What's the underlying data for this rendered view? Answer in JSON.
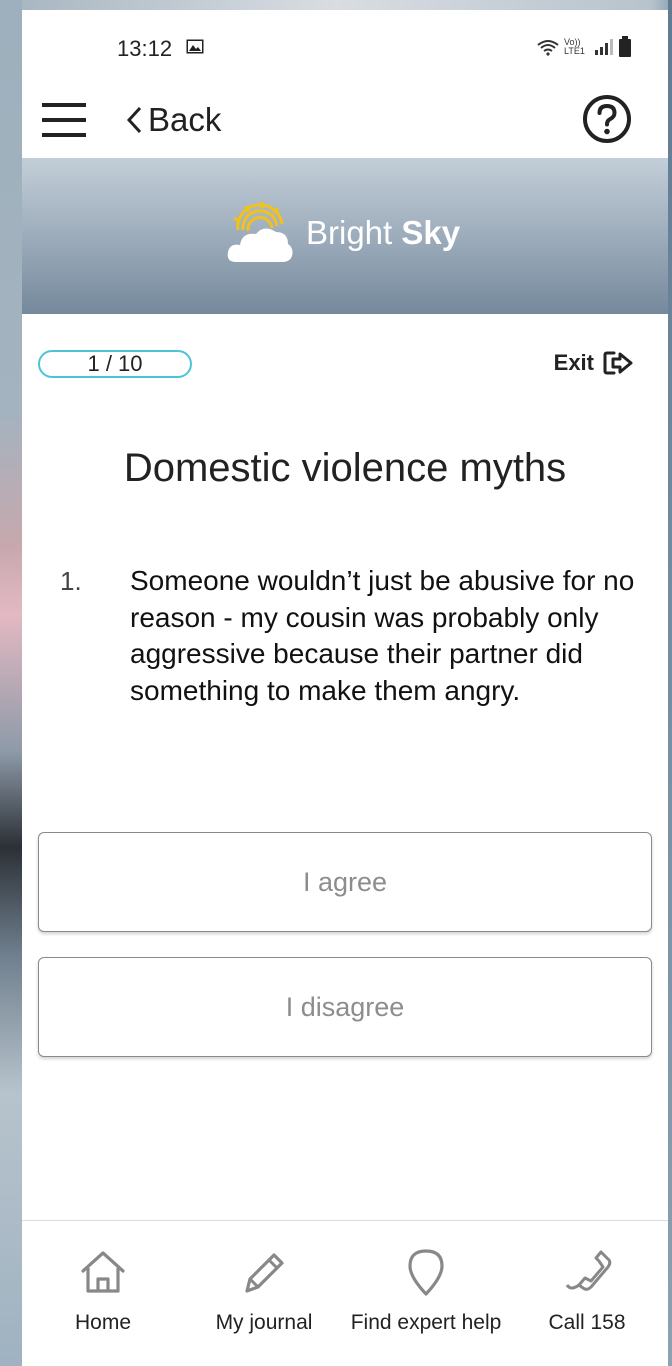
{
  "status_bar": {
    "time": "13:12",
    "network_label": "Vo)) LTE1"
  },
  "header": {
    "back_label": "Back"
  },
  "brand": {
    "name_light": "Bright ",
    "name_bold": "Sky"
  },
  "quiz": {
    "progress": "1 / 10",
    "exit_label": "Exit",
    "title": "Domestic violence myths",
    "question_number": "1.",
    "question_text": "Someone wouldn’t just be abusive for no reason - my cousin was probably only aggressive because their partner did something to make them angry.",
    "answers": [
      "I agree",
      "I disagree"
    ]
  },
  "bottom_nav": {
    "items": [
      {
        "label": "Home",
        "icon": "home-icon"
      },
      {
        "label": "My journal",
        "icon": "pencil-icon"
      },
      {
        "label": "Find expert help",
        "icon": "location-pin-icon"
      },
      {
        "label": "Call 158",
        "icon": "phone-icon"
      }
    ]
  },
  "colors": {
    "accent": "#4fc3d6",
    "logo_sun": "#f2c21b",
    "banner_top": "#c3ced8",
    "banner_bottom": "#75899c",
    "answer_text": "#8d8d8d"
  }
}
